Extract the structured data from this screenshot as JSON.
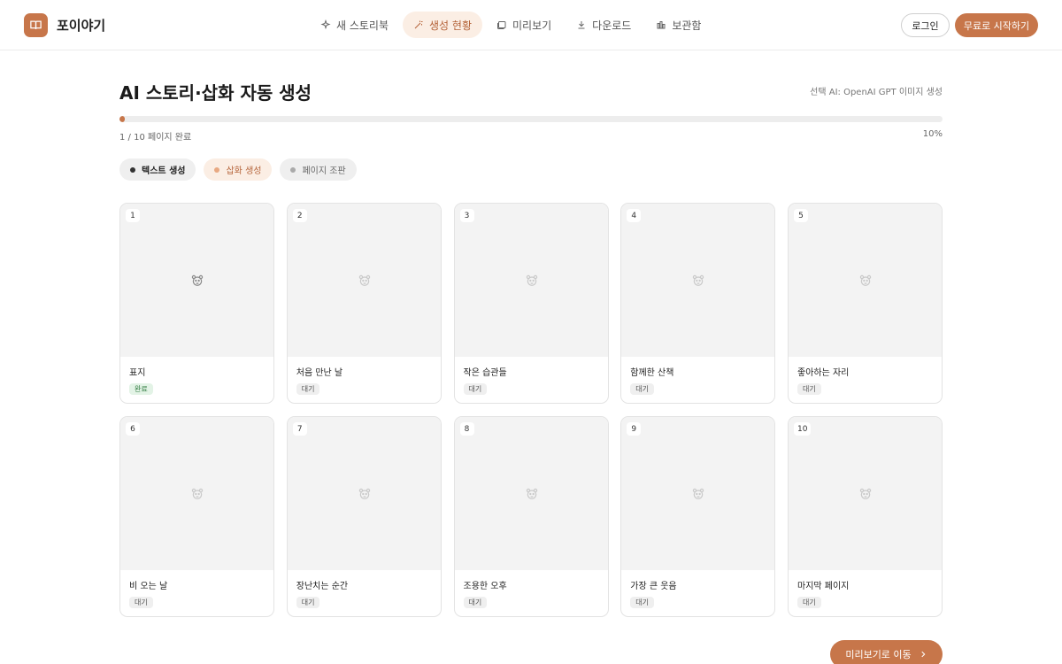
{
  "header": {
    "brand": "포이야기",
    "brand_icon": "book-icon",
    "nav": [
      {
        "label": "새 스토리북",
        "icon": "sparkle-icon",
        "active": false
      },
      {
        "label": "생성 현황",
        "icon": "wand-icon",
        "active": true
      },
      {
        "label": "미리보기",
        "icon": "gallery-icon",
        "active": false
      },
      {
        "label": "다운로드",
        "icon": "download-icon",
        "active": false
      },
      {
        "label": "보관함",
        "icon": "library-icon",
        "active": false
      }
    ],
    "login_label": "로그인",
    "start_label": "무료로 시작하기"
  },
  "main": {
    "title": "AI 스토리·삽화 자동 생성",
    "ai_label": "선택 AI: OpenAI GPT 이미지 생성",
    "progress": {
      "value": 0.1,
      "text": "1 / 10 페이지 완료",
      "percent": "10%"
    },
    "steps": [
      {
        "label": "텍스트 생성",
        "state": "active"
      },
      {
        "label": "삽화 생성",
        "state": "current"
      },
      {
        "label": "페이지 조판",
        "state": "pending"
      }
    ],
    "pages": [
      {
        "num": "1",
        "title": "표지",
        "status": "완료",
        "done": true
      },
      {
        "num": "2",
        "title": "처음 만난 날",
        "status": "대기",
        "done": false
      },
      {
        "num": "3",
        "title": "작은 습관들",
        "status": "대기",
        "done": false
      },
      {
        "num": "4",
        "title": "함께한 산책",
        "status": "대기",
        "done": false
      },
      {
        "num": "5",
        "title": "좋아하는 자리",
        "status": "대기",
        "done": false
      },
      {
        "num": "6",
        "title": "비 오는 날",
        "status": "대기",
        "done": false
      },
      {
        "num": "7",
        "title": "장난치는 순간",
        "status": "대기",
        "done": false
      },
      {
        "num": "8",
        "title": "조용한 오후",
        "status": "대기",
        "done": false
      },
      {
        "num": "9",
        "title": "가장 큰 웃음",
        "status": "대기",
        "done": false
      },
      {
        "num": "10",
        "title": "마지막 페이지",
        "status": "대기",
        "done": false
      }
    ],
    "preview_button": "미리보기로 이동",
    "accent": "#c7764a"
  }
}
